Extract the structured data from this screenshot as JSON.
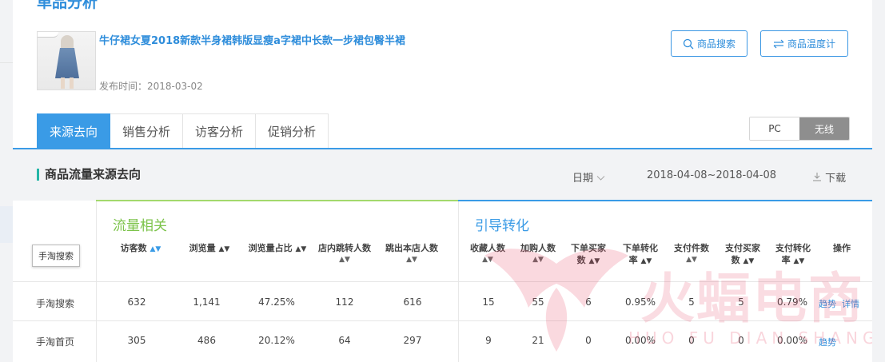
{
  "page_title": "单品分析",
  "product": {
    "title": "牛仔裙女夏2018新款半身裙韩版显瘦a字裙中长款一步裙包臀半裙",
    "date_label": "发布时间：",
    "date_value": "2018-03-02"
  },
  "buttons": {
    "search": "商品搜索",
    "temperature": "商品温度计"
  },
  "tabs": [
    "来源去向",
    "销售分析",
    "访客分析",
    "促销分析"
  ],
  "device": {
    "pc": "PC",
    "wireless": "无线"
  },
  "section": {
    "title": "商品流量来源去向",
    "date_label": "日期",
    "date_range": "2018-04-08~2018-04-08",
    "download": "下载"
  },
  "groups": {
    "traffic": "流量相关",
    "conversion": "引导转化"
  },
  "tooltip": "手淘搜索",
  "columns": {
    "visitors": "访客数",
    "views": "浏览量",
    "view_share": "浏览量占比",
    "inner_jump": "店内跳转人数",
    "exit": "跳出本店人数",
    "fav": "收藏人数",
    "cart": "加购人数",
    "buyers_1": "下单买家",
    "buyers_2": "数",
    "order_conv_1": "下单转化",
    "order_conv_2": "率",
    "pay_items": "支付件数",
    "pay_buyers_1": "支付买家",
    "pay_buyers_2": "数",
    "pay_conv_1": "支付转化",
    "pay_conv_2": "率",
    "action": "操作"
  },
  "rows": [
    {
      "source": "手淘搜索",
      "visitors": "632",
      "views": "1,141",
      "view_share": "47.25%",
      "inner_jump": "112",
      "exit": "616",
      "fav": "15",
      "cart": "55",
      "buyers": "6",
      "order_conv": "0.95%",
      "pay_items": "5",
      "pay_buyers": "5",
      "pay_conv": "0.79%",
      "action_trend": "趋势",
      "action_detail": "详情"
    },
    {
      "source": "手淘首页",
      "visitors": "305",
      "views": "486",
      "view_share": "20.12%",
      "inner_jump": "64",
      "exit": "297",
      "fav": "9",
      "cart": "21",
      "buyers": "0",
      "order_conv": "0.00%",
      "pay_items": "0",
      "pay_buyers": "0",
      "pay_conv": "0.00%",
      "action_trend": "趋势"
    }
  ],
  "watermark": {
    "main": "火蝠电商",
    "sub": "HUO FU DIAN SHANG"
  },
  "icons": {
    "sort": "sort-arrows",
    "sort_active": "sort-arrows-active",
    "search": "search-icon",
    "swap": "swap-icon",
    "chevron": "chevron-down-icon",
    "download": "download-icon"
  },
  "colors": {
    "accent": "#3a9be6",
    "link": "#2e8ddb",
    "green": "#7cc34a",
    "watermark": "#e84464"
  }
}
